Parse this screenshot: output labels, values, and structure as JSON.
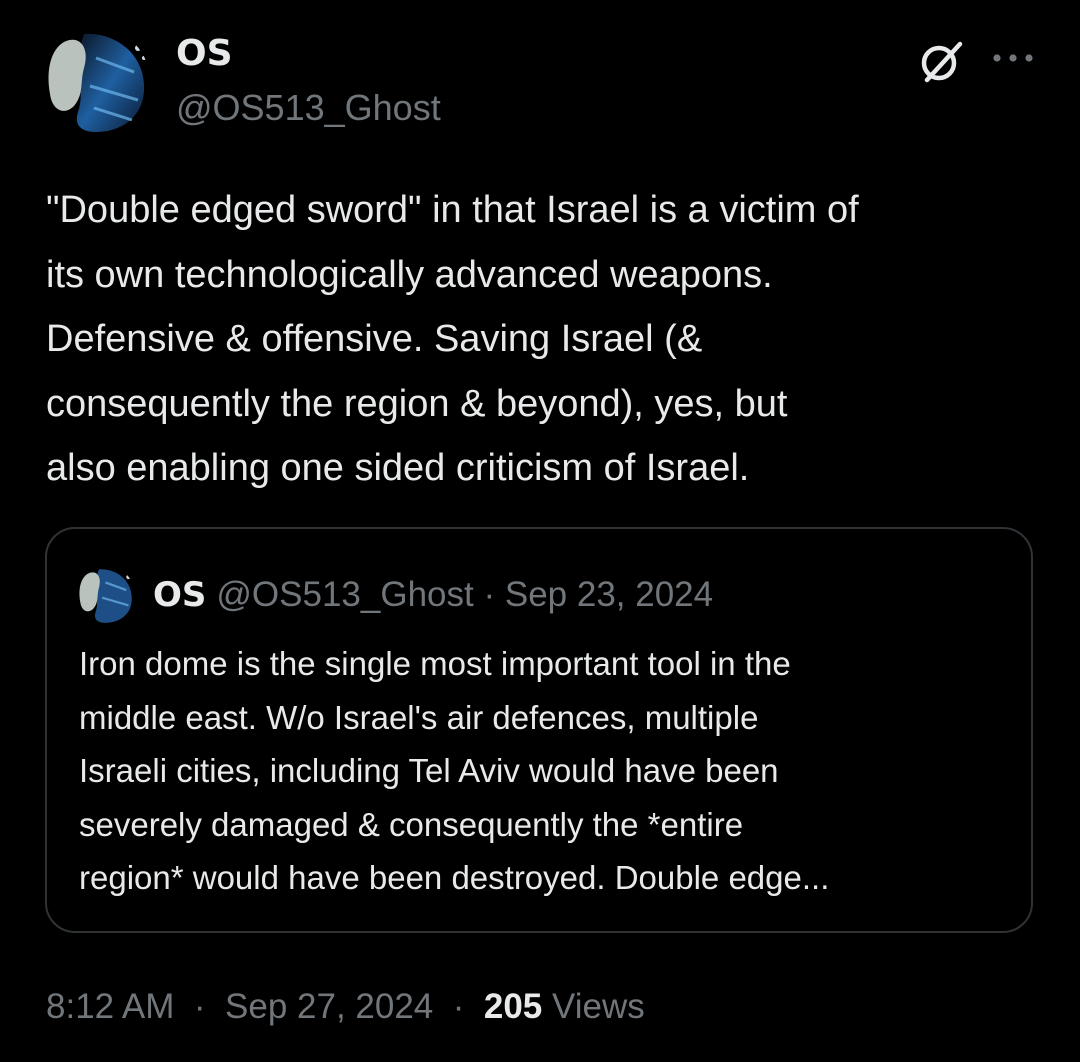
{
  "author": {
    "display_name": "OS",
    "handle": "@OS513_Ghost"
  },
  "tweet": {
    "text": "\"Double edged sword\" in that Israel is a victim of\nits own technologically advanced weapons.\nDefensive & offensive. Saving Israel (&\nconsequently the region & beyond), yes, but\nalso enabling one sided criticism of Israel."
  },
  "quoted_tweet": {
    "display_name": "OS",
    "handle": "@OS513_Ghost",
    "separator": "·",
    "date": "Sep 23, 2024",
    "text": "Iron dome is the single most important tool in the\nmiddle east. W/o Israel's air defences, multiple\nIsraeli cities, including Tel Aviv would have been\nseverely damaged & consequently the *entire\nregion* would have been destroyed. Double edge..."
  },
  "footer": {
    "time": "8:12 AM",
    "sep1": "·",
    "date": "Sep 27, 2024",
    "sep2": "·",
    "views_count": "205",
    "views_label": "Views"
  },
  "icons": {
    "grok": "grok-slash-circle-icon",
    "more": "more-horizontal-icon"
  },
  "colors": {
    "background": "#000000",
    "primary_text": "#e7e9ea",
    "secondary_text": "#71767b",
    "border": "#2f3336"
  }
}
